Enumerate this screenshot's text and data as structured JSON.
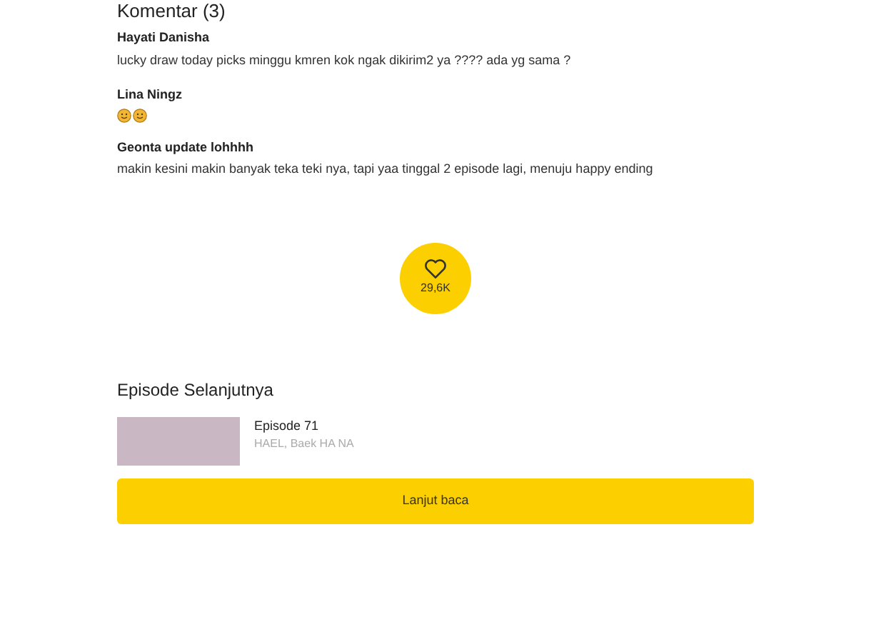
{
  "comments_title": "Komentar (3)",
  "comments": [
    {
      "author": "Hayati Danisha",
      "text": "lucky draw today picks minggu kmren kok ngak dikirim2 ya ???? ada yg sama ?"
    },
    {
      "author": "Lina Ningz",
      "emojis": [
        {
          "kind": "smile"
        },
        {
          "kind": "smile"
        }
      ]
    },
    {
      "author": "Geonta update lohhhh",
      "text": "makin kesini makin banyak teka teki nya, tapi yaa tinggal 2 episode lagi, menuju happy ending"
    }
  ],
  "like": {
    "count": "29,6K"
  },
  "next": {
    "title": "Episode Selanjutnya",
    "episode": "Episode 71",
    "authors": "HAEL, Baek HA NA",
    "button": "Lanjut baca"
  }
}
